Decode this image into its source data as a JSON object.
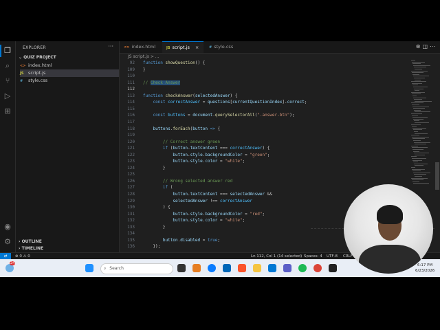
{
  "explorer": {
    "title": "EXPLORER",
    "more": "···",
    "project": "QUIZ PROJECT",
    "files": [
      {
        "badge": "<>",
        "name": "index.html",
        "color": "#e37933"
      },
      {
        "badge": "JS",
        "name": "script.js",
        "color": "#cbcb41"
      },
      {
        "badge": "#",
        "name": "style.css",
        "color": "#519aba"
      }
    ],
    "outline": "OUTLINE",
    "timeline": "TIMELINE"
  },
  "tabs": [
    {
      "badge": "<>",
      "name": "index.html",
      "color": "#e37933"
    },
    {
      "badge": "JS",
      "name": "script.js",
      "color": "#cbcb41"
    },
    {
      "badge": "#",
      "name": "style.css",
      "color": "#519aba"
    }
  ],
  "breadcrumb": "JS script.js > ...",
  "code_lines": [
    {
      "n": "92",
      "html": "<span class='k'>function</span> <span class='f'>showQuestion</span>() {"
    },
    {
      "n": "109",
      "html": "}"
    },
    {
      "n": "110",
      "html": ""
    },
    {
      "n": "111",
      "html": "<span class='c'>// </span><span class='c hl'>Check Answer</span>"
    },
    {
      "n": "112",
      "html": ""
    },
    {
      "n": "113",
      "html": "<span class='k'>function</span> <span class='f'>checkAnswer</span>(<span class='v'>selectedAnswer</span>) {"
    },
    {
      "n": "114",
      "html": "    <span class='k'>const</span> <span class='n'>correctAnswer</span> = <span class='v'>questions</span>[<span class='v'>currentQuestionIndex</span>].<span class='v'>correct</span>;"
    },
    {
      "n": "115",
      "html": ""
    },
    {
      "n": "116",
      "html": "    <span class='k'>const</span> <span class='n'>buttons</span> = <span class='v'>document</span>.<span class='f'>querySelectorAll</span>(<span class='s'>\".answer-btn\"</span>);"
    },
    {
      "n": "117",
      "html": ""
    },
    {
      "n": "118",
      "html": "    <span class='v'>buttons</span>.<span class='f'>forEach</span>(<span class='v'>button</span> <span class='k'>=&gt;</span> {"
    },
    {
      "n": "119",
      "html": ""
    },
    {
      "n": "120",
      "html": "        <span class='c'>// Correct answer green</span>"
    },
    {
      "n": "121",
      "html": "        <span class='k'>if</span> (<span class='v'>button</span>.<span class='v'>textContent</span> === <span class='n'>correctAnswer</span>) {"
    },
    {
      "n": "122",
      "html": "            <span class='v'>button</span>.<span class='v'>style</span>.<span class='v'>backgroundColor</span> = <span class='s'>\"green\"</span>;"
    },
    {
      "n": "123",
      "html": "            <span class='v'>button</span>.<span class='v'>style</span>.<span class='v'>color</span> = <span class='s'>\"white\"</span>;"
    },
    {
      "n": "124",
      "html": "        }"
    },
    {
      "n": "125",
      "html": ""
    },
    {
      "n": "126",
      "html": "        <span class='c'>// Wrong selected answer red</span>"
    },
    {
      "n": "127",
      "html": "        <span class='k'>if</span> ("
    },
    {
      "n": "128",
      "html": "            <span class='v'>button</span>.<span class='v'>textContent</span> === <span class='v'>selectedAnswer</span> &amp;&amp;"
    },
    {
      "n": "129",
      "html": "            <span class='v'>selectedAnswer</span> !== <span class='n'>correctAnswer</span>"
    },
    {
      "n": "130",
      "html": "        ) {"
    },
    {
      "n": "131",
      "html": "            <span class='v'>button</span>.<span class='v'>style</span>.<span class='v'>backgroundColor</span> = <span class='s'>\"red\"</span>;"
    },
    {
      "n": "132",
      "html": "            <span class='v'>button</span>.<span class='v'>style</span>.<span class='v'>color</span> = <span class='s'>\"white\"</span>;"
    },
    {
      "n": "133",
      "html": "        }"
    },
    {
      "n": "134",
      "html": ""
    },
    {
      "n": "135",
      "html": "        <span class='v'>button</span>.<span class='v'>disabled</span> = <span class='k'>true</span>;"
    },
    {
      "n": "136",
      "html": "    });"
    }
  ],
  "status": {
    "remote": "⇄",
    "problems": "⊗ 0 ⚠ 0",
    "cursor": "Ln 112, Col 1 (14 selected)",
    "spaces": "Spaces: 4",
    "encoding": "UTF-8",
    "eol": "CRLF"
  },
  "taskbar": {
    "search_placeholder": "Search",
    "time": "6:17 PM",
    "date": "6/23/2026",
    "weather_badge": "24"
  }
}
